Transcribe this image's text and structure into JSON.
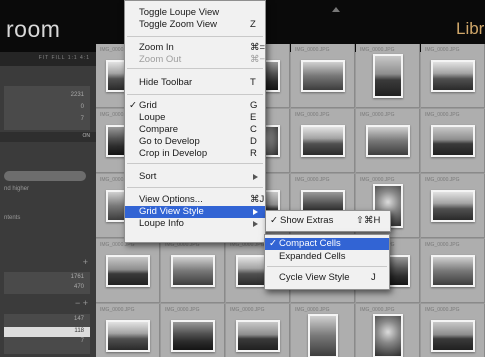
{
  "app": {
    "title_left": "room",
    "title_right": "Libr"
  },
  "navigator": {
    "zoom_options": "FIT  FILL  1:1  4:1"
  },
  "left_panel": {
    "counts_top": [
      "2231",
      "0",
      "7"
    ],
    "filter_on": "ON",
    "filter_text": "nd higher",
    "filter_items": "ntents",
    "counts_mid": [
      "1761",
      "470"
    ],
    "counts_bottom": [
      "147",
      "118",
      "7"
    ],
    "selected_count": "118"
  },
  "grid": {
    "cell_label": "IMG_0000.JPG",
    "cells": [
      {
        "orientation": "land",
        "tone": "t1"
      },
      {
        "orientation": "land",
        "tone": "t0"
      },
      {
        "orientation": "land",
        "tone": "t2"
      },
      {
        "orientation": "land",
        "tone": "t3"
      },
      {
        "orientation": "port",
        "tone": "t0"
      },
      {
        "orientation": "land",
        "tone": "t1"
      },
      {
        "orientation": "land",
        "tone": "t2"
      },
      {
        "orientation": "land",
        "tone": "t0"
      },
      {
        "orientation": "land",
        "tone": "t4"
      },
      {
        "orientation": "land",
        "tone": "t1"
      },
      {
        "orientation": "land",
        "tone": "t3"
      },
      {
        "orientation": "land",
        "tone": "t0"
      },
      {
        "orientation": "land",
        "tone": "t3"
      },
      {
        "orientation": "land",
        "tone": "t1"
      },
      {
        "orientation": "land",
        "tone": "t0"
      },
      {
        "orientation": "land",
        "tone": "t2"
      },
      {
        "orientation": "port",
        "tone": "t4"
      },
      {
        "orientation": "land",
        "tone": "t1"
      },
      {
        "orientation": "land",
        "tone": "t0"
      },
      {
        "orientation": "land",
        "tone": "t3"
      },
      {
        "orientation": "land",
        "tone": "t1"
      },
      {
        "orientation": "land",
        "tone": "t0"
      },
      {
        "orientation": "land",
        "tone": "t2"
      },
      {
        "orientation": "land",
        "tone": "t3"
      },
      {
        "orientation": "land",
        "tone": "t1"
      },
      {
        "orientation": "land",
        "tone": "t2"
      },
      {
        "orientation": "land",
        "tone": "t0"
      },
      {
        "orientation": "port",
        "tone": "t3"
      },
      {
        "orientation": "port",
        "tone": "t4"
      },
      {
        "orientation": "land",
        "tone": "t0"
      }
    ]
  },
  "view_menu": {
    "items": [
      {
        "label": "Toggle Loupe View",
        "key": "",
        "state": "normal"
      },
      {
        "label": "Toggle Zoom View",
        "key": "Z",
        "state": "normal"
      },
      {
        "label": "Zoom In",
        "key": "⌘=",
        "state": "normal"
      },
      {
        "label": "Zoom Out",
        "key": "⌘−",
        "state": "disabled"
      },
      {
        "label": "Hide Toolbar",
        "key": "T",
        "state": "normal"
      },
      {
        "label": "Grid",
        "key": "G",
        "state": "checked"
      },
      {
        "label": "Loupe",
        "key": "E",
        "state": "normal"
      },
      {
        "label": "Compare",
        "key": "C",
        "state": "normal"
      },
      {
        "label": "Go to Develop",
        "key": "D",
        "state": "normal"
      },
      {
        "label": "Crop in Develop",
        "key": "R",
        "state": "normal"
      },
      {
        "label": "Sort",
        "key": "",
        "state": "submenu"
      },
      {
        "label": "View Options...",
        "key": "⌘J",
        "state": "normal"
      },
      {
        "label": "Grid View Style",
        "key": "",
        "state": "highlighted"
      },
      {
        "label": "Loupe Info",
        "key": "",
        "state": "submenu"
      }
    ],
    "check_mark": "✓"
  },
  "grid_style_submenu": {
    "items": [
      {
        "label": "Show Extras",
        "key": "⇧⌘H",
        "state": "checked"
      }
    ]
  },
  "cells_submenu": {
    "items": [
      {
        "label": "Compact Cells",
        "key": "",
        "state": "checked-highlighted"
      },
      {
        "label": "Expanded Cells",
        "key": "",
        "state": "normal"
      },
      {
        "label": "Cycle View Style",
        "key": "J",
        "state": "normal"
      }
    ]
  },
  "colors": {
    "menu_highlight": "#3264d4",
    "accent_title": "#d0a76a"
  }
}
